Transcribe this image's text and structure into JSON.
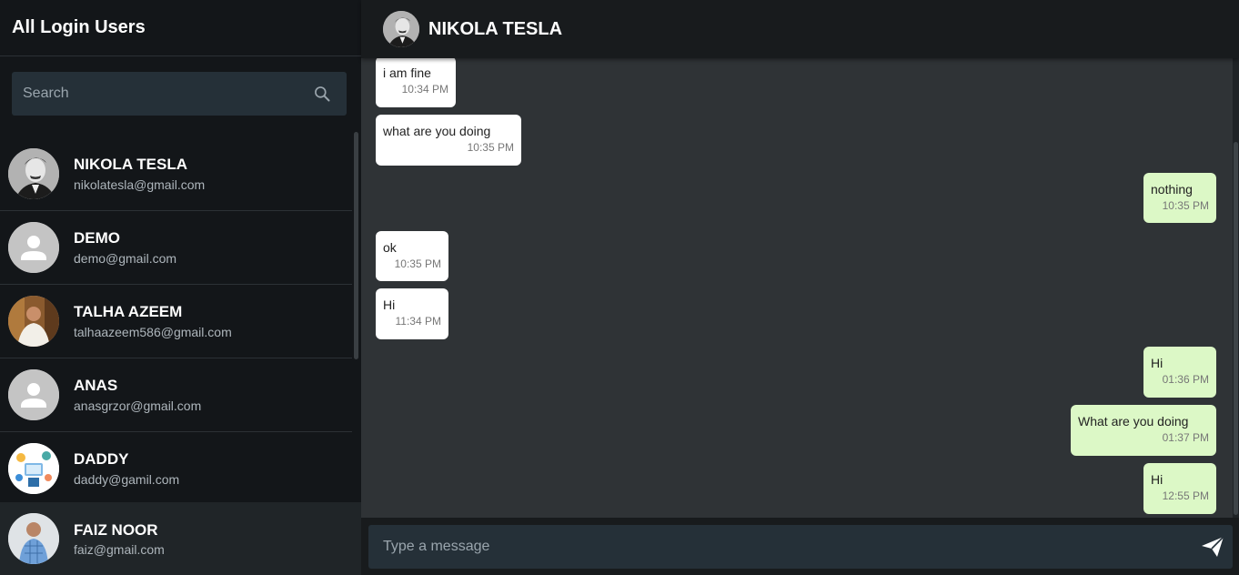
{
  "sidebar": {
    "title": "All Login Users",
    "search_placeholder": "Search",
    "users": [
      {
        "name": "NIKOLA TESLA",
        "email": "nikolatesla@gmail.com",
        "avatar": "photo"
      },
      {
        "name": "DEMO",
        "email": "demo@gmail.com",
        "avatar": "default"
      },
      {
        "name": "TALHA AZEEM",
        "email": "talhaazeem586@gmail.com",
        "avatar": "photo"
      },
      {
        "name": "ANAS",
        "email": "anasgrzor@gmail.com",
        "avatar": "default"
      },
      {
        "name": "DADDY",
        "email": "daddy@gamil.com",
        "avatar": "illustration"
      }
    ],
    "current_user": {
      "name": "FAIZ NOOR",
      "email": "faiz@gmail.com"
    }
  },
  "chat": {
    "title": "NIKOLA TESLA",
    "messages": [
      {
        "text": "i am fine",
        "time": "10:34 PM",
        "direction": "in"
      },
      {
        "text": "what are you doing",
        "time": "10:35 PM",
        "direction": "in"
      },
      {
        "text": "nothing",
        "time": "10:35 PM",
        "direction": "out"
      },
      {
        "text": "ok",
        "time": "10:35 PM",
        "direction": "in"
      },
      {
        "text": "Hi",
        "time": "11:34 PM",
        "direction": "in"
      },
      {
        "text": "Hi",
        "time": "01:36 PM",
        "direction": "out"
      },
      {
        "text": "What are you doing",
        "time": "01:37 PM",
        "direction": "out"
      },
      {
        "text": "Hi",
        "time": "12:55 PM",
        "direction": "out"
      }
    ],
    "composer_placeholder": "Type a message"
  },
  "icons": {
    "search": "search-icon",
    "send": "send-icon",
    "default_avatar": "person-icon"
  },
  "colors": {
    "sidebar_bg": "#131619",
    "chat_bg": "#2f3336",
    "incoming_bubble": "#ffffff",
    "outgoing_bubble": "#dcf8c6",
    "input_bg": "#253038"
  }
}
